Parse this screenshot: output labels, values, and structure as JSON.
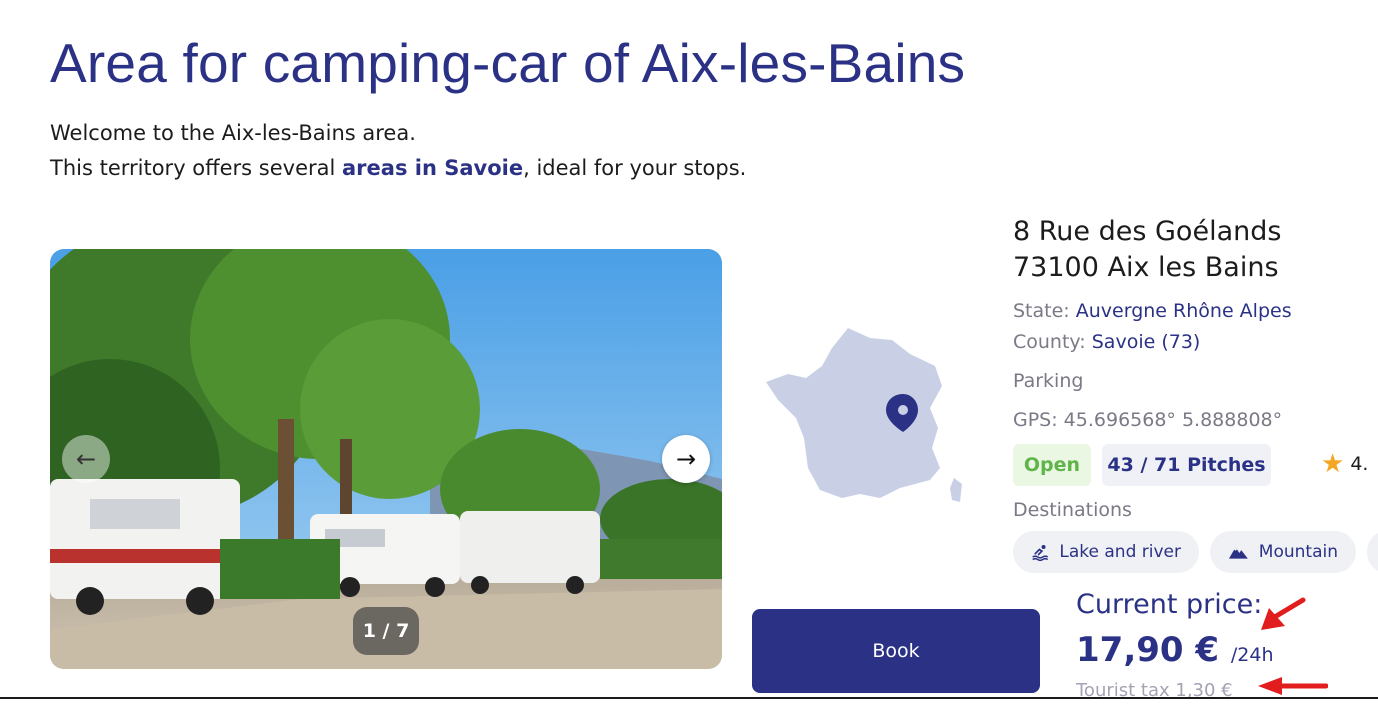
{
  "header": {
    "title": "Area for camping-car of Aix-les-Bains"
  },
  "intro": {
    "line1": "Welcome to the Aix-les-Bains area.",
    "line2_before": "This territory offers several ",
    "line2_link": "areas in Savoie",
    "line2_after": ", ideal for your stops."
  },
  "carousel": {
    "counter": "1 / 7",
    "prev_icon": "arrow-left-icon",
    "next_icon": "arrow-right-icon"
  },
  "map": {
    "icon": "location-pin-icon"
  },
  "address": {
    "street": "8 Rue des Goélands",
    "city": "73100 Aix les Bains"
  },
  "details": {
    "state_label": "State:",
    "state_value": "Auvergne Rhône Alpes",
    "county_label": "County:",
    "county_value": "Savoie (73)",
    "type": "Parking",
    "gps": "GPS: 45.696568° 5.888808°"
  },
  "status": {
    "open": "Open",
    "pitches": "43 / 71 Pitches",
    "rating": "4."
  },
  "destinations": {
    "label": "Destinations",
    "items": [
      {
        "label": "Lake and river",
        "icon": "swimmer-icon"
      },
      {
        "label": "Mountain",
        "icon": "mountain-icon"
      }
    ]
  },
  "pricing": {
    "label": "Current price:",
    "value": "17,90 €",
    "unit": "/24h",
    "tax": "Tourist tax 1,30 €"
  },
  "actions": {
    "book_label": "Book"
  },
  "colors": {
    "brand": "#2b3286",
    "open_green": "#5fb54a",
    "annotation_arrow": "#e11d1d"
  }
}
